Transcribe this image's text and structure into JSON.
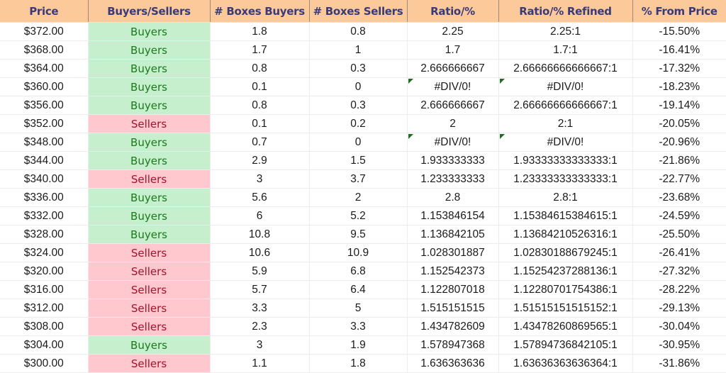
{
  "columns": [
    "Price",
    "Buyers/Sellers",
    "# Boxes Buyers",
    "# Boxes Sellers",
    "Ratio/%",
    "Ratio/% Refined",
    "% From Price"
  ],
  "colors": {
    "header_bg": "#fcc99b",
    "header_text": "#3a3a78",
    "buyers_bg": "#c6efce",
    "buyers_text": "#1b7a1b",
    "sellers_bg": "#ffc7ce",
    "sellers_text": "#a5112a",
    "error_marker": "#1e6e1e"
  },
  "rows": [
    {
      "price": "$372.00",
      "side": "Buyers",
      "boxes_buyers": "1.8",
      "boxes_sellers": "0.8",
      "ratio": "2.25",
      "ratio_refined": "2.25:1",
      "pct_from_price": "-15.50%"
    },
    {
      "price": "$368.00",
      "side": "Buyers",
      "boxes_buyers": "1.7",
      "boxes_sellers": "1",
      "ratio": "1.7",
      "ratio_refined": "1.7:1",
      "pct_from_price": "-16.41%"
    },
    {
      "price": "$364.00",
      "side": "Buyers",
      "boxes_buyers": "0.8",
      "boxes_sellers": "0.3",
      "ratio": "2.666666667",
      "ratio_refined": "2.66666666666667:1",
      "pct_from_price": "-17.32%"
    },
    {
      "price": "$360.00",
      "side": "Buyers",
      "boxes_buyers": "0.1",
      "boxes_sellers": "0",
      "ratio": "#DIV/0!",
      "ratio_refined": "#DIV/0!",
      "pct_from_price": "-18.23%",
      "error": true
    },
    {
      "price": "$356.00",
      "side": "Buyers",
      "boxes_buyers": "0.8",
      "boxes_sellers": "0.3",
      "ratio": "2.666666667",
      "ratio_refined": "2.66666666666667:1",
      "pct_from_price": "-19.14%"
    },
    {
      "price": "$352.00",
      "side": "Sellers",
      "boxes_buyers": "0.1",
      "boxes_sellers": "0.2",
      "ratio": "2",
      "ratio_refined": "2:1",
      "pct_from_price": "-20.05%"
    },
    {
      "price": "$348.00",
      "side": "Buyers",
      "boxes_buyers": "0.7",
      "boxes_sellers": "0",
      "ratio": "#DIV/0!",
      "ratio_refined": "#DIV/0!",
      "pct_from_price": "-20.96%",
      "error": true
    },
    {
      "price": "$344.00",
      "side": "Buyers",
      "boxes_buyers": "2.9",
      "boxes_sellers": "1.5",
      "ratio": "1.933333333",
      "ratio_refined": "1.93333333333333:1",
      "pct_from_price": "-21.86%"
    },
    {
      "price": "$340.00",
      "side": "Sellers",
      "boxes_buyers": "3",
      "boxes_sellers": "3.7",
      "ratio": "1.233333333",
      "ratio_refined": "1.23333333333333:1",
      "pct_from_price": "-22.77%"
    },
    {
      "price": "$336.00",
      "side": "Buyers",
      "boxes_buyers": "5.6",
      "boxes_sellers": "2",
      "ratio": "2.8",
      "ratio_refined": "2.8:1",
      "pct_from_price": "-23.68%"
    },
    {
      "price": "$332.00",
      "side": "Buyers",
      "boxes_buyers": "6",
      "boxes_sellers": "5.2",
      "ratio": "1.153846154",
      "ratio_refined": "1.15384615384615:1",
      "pct_from_price": "-24.59%"
    },
    {
      "price": "$328.00",
      "side": "Buyers",
      "boxes_buyers": "10.8",
      "boxes_sellers": "9.5",
      "ratio": "1.136842105",
      "ratio_refined": "1.13684210526316:1",
      "pct_from_price": "-25.50%"
    },
    {
      "price": "$324.00",
      "side": "Sellers",
      "boxes_buyers": "10.6",
      "boxes_sellers": "10.9",
      "ratio": "1.028301887",
      "ratio_refined": "1.02830188679245:1",
      "pct_from_price": "-26.41%"
    },
    {
      "price": "$320.00",
      "side": "Sellers",
      "boxes_buyers": "5.9",
      "boxes_sellers": "6.8",
      "ratio": "1.152542373",
      "ratio_refined": "1.15254237288136:1",
      "pct_from_price": "-27.32%"
    },
    {
      "price": "$316.00",
      "side": "Sellers",
      "boxes_buyers": "5.7",
      "boxes_sellers": "6.4",
      "ratio": "1.122807018",
      "ratio_refined": "1.12280701754386:1",
      "pct_from_price": "-28.22%"
    },
    {
      "price": "$312.00",
      "side": "Sellers",
      "boxes_buyers": "3.3",
      "boxes_sellers": "5",
      "ratio": "1.515151515",
      "ratio_refined": "1.51515151515152:1",
      "pct_from_price": "-29.13%"
    },
    {
      "price": "$308.00",
      "side": "Sellers",
      "boxes_buyers": "2.3",
      "boxes_sellers": "3.3",
      "ratio": "1.434782609",
      "ratio_refined": "1.43478260869565:1",
      "pct_from_price": "-30.04%"
    },
    {
      "price": "$304.00",
      "side": "Buyers",
      "boxes_buyers": "3",
      "boxes_sellers": "1.9",
      "ratio": "1.578947368",
      "ratio_refined": "1.57894736842105:1",
      "pct_from_price": "-30.95%"
    },
    {
      "price": "$300.00",
      "side": "Sellers",
      "boxes_buyers": "1.1",
      "boxes_sellers": "1.8",
      "ratio": "1.636363636",
      "ratio_refined": "1.63636363636364:1",
      "pct_from_price": "-31.86%"
    }
  ]
}
